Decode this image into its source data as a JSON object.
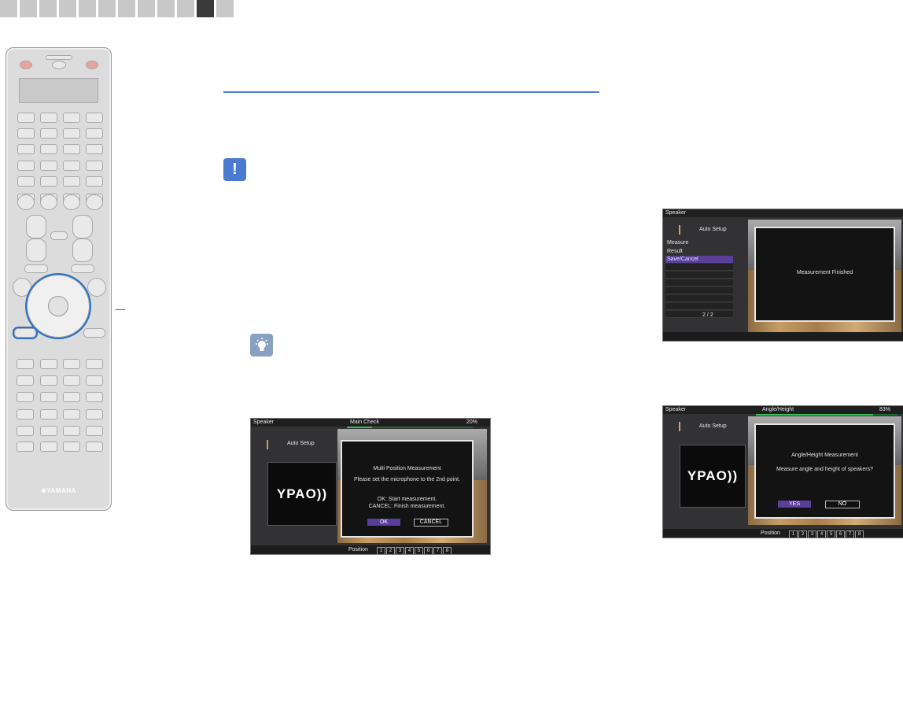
{
  "tabs": {
    "count": 12,
    "active_index": 10
  },
  "remote": {
    "brand": "⊛YAMAHA"
  },
  "icons": {
    "notice": "notice-icon",
    "hint": "lightbulb-icon",
    "notice_glyph": "!"
  },
  "screen_main_check": {
    "header_title": "Speaker",
    "header_step": "Main Check",
    "progress_text": "20%",
    "progress": 0.2,
    "auto_setup": "Auto Setup",
    "logo": "YPAO))",
    "title": "Multi Position Measurement",
    "line1": "Please set the microphone to the 2nd point.",
    "ok_line": "OK:  Start measurement.",
    "cancel_line": "CANCEL:  Finish measurement.",
    "ok_button": "OK",
    "cancel_button": "CANCEL",
    "position_label": "Position",
    "positions": [
      "1",
      "2",
      "3",
      "4",
      "5",
      "6",
      "7",
      "8"
    ]
  },
  "screen_finished": {
    "header_title": "Speaker",
    "auto_setup": "Auto Setup",
    "menu_title": "Measure",
    "menu_items": [
      "Result",
      "Save/Cancel"
    ],
    "page": "2 / 2",
    "message": "Measurement Finished"
  },
  "screen_angle": {
    "header_title": "Speaker",
    "header_step": "Angle/Height",
    "progress_text": "83%",
    "progress": 0.83,
    "auto_setup": "Auto Setup",
    "logo": "YPAO))",
    "title": "Angle/Height Measurement",
    "question": "Measure angle and height of speakers?",
    "yes_button": "YES",
    "no_button": "NO",
    "position_label": "Position",
    "positions": [
      "1",
      "2",
      "3",
      "4",
      "5",
      "6",
      "7",
      "8"
    ]
  }
}
